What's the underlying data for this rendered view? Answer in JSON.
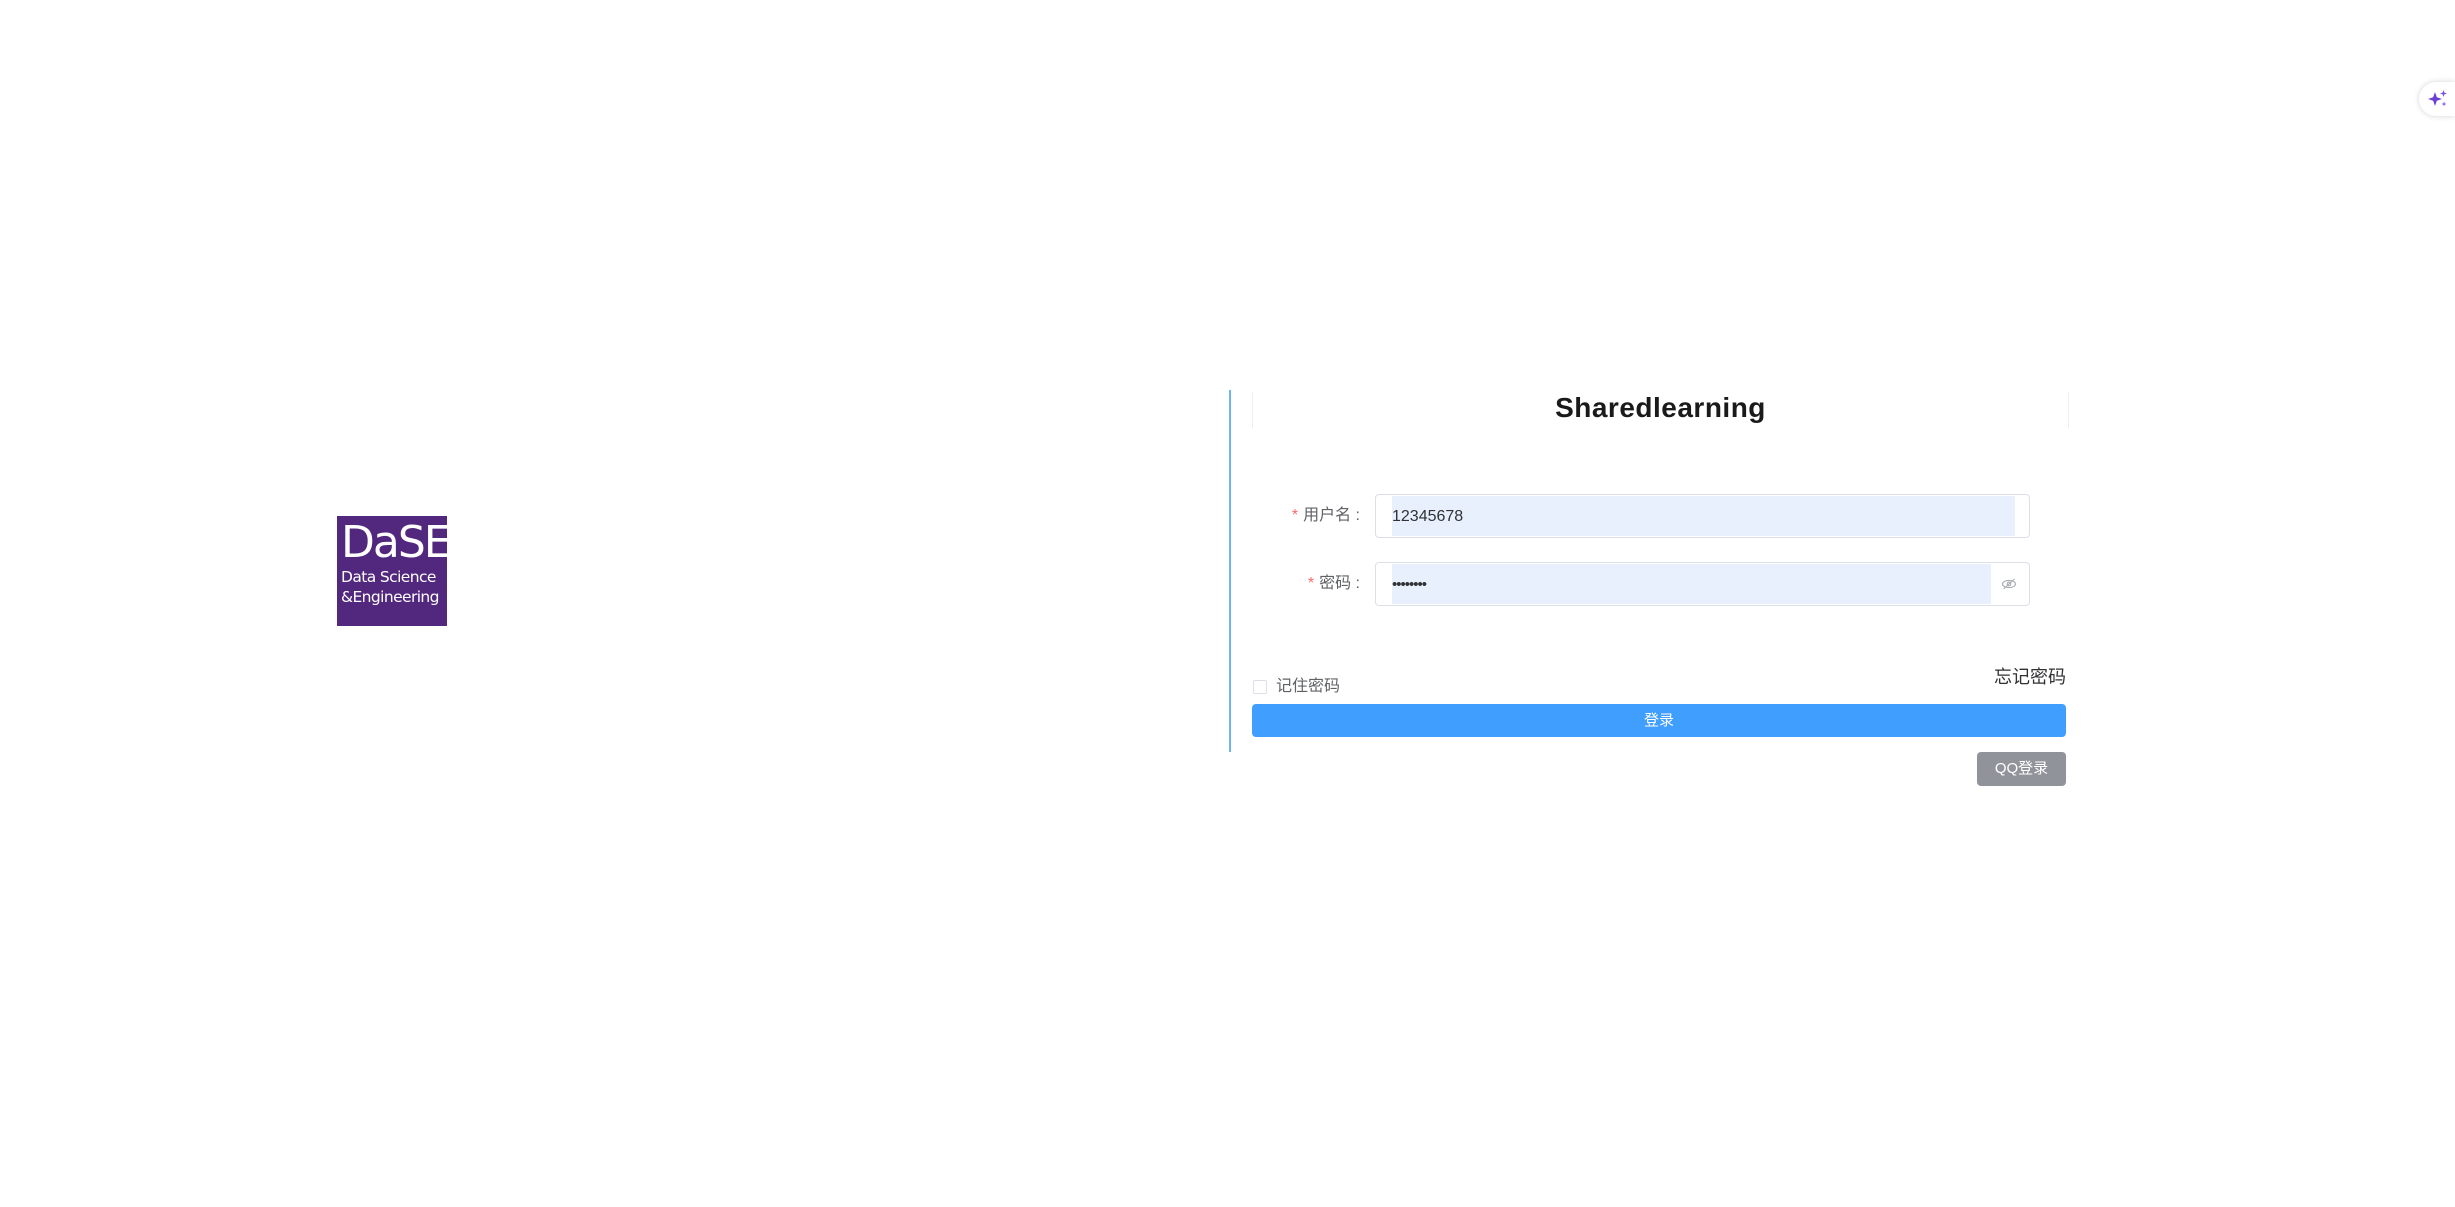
{
  "logo": {
    "line1": "DaSE",
    "line2": "Data Science",
    "line3": "&Engineering",
    "color": "#51287e"
  },
  "login": {
    "title": "Sharedlearning",
    "required_mark": "*",
    "username_label": "用户名 :",
    "username_value": "12345678",
    "password_label": "密码 :",
    "password_value": "••••••••",
    "remember_label": "记住密码",
    "forgot_label": "忘记密码",
    "login_button": "登录",
    "qq_button": "QQ登录"
  },
  "colors": {
    "primary": "#409eff",
    "qq_button": "#909399",
    "divider": "#6cb6f5",
    "autofill": "#e8f0fe",
    "required": "#f56c6c"
  },
  "icons": {
    "password_toggle": "eye-icon",
    "assistant": "sparkle-icon"
  }
}
